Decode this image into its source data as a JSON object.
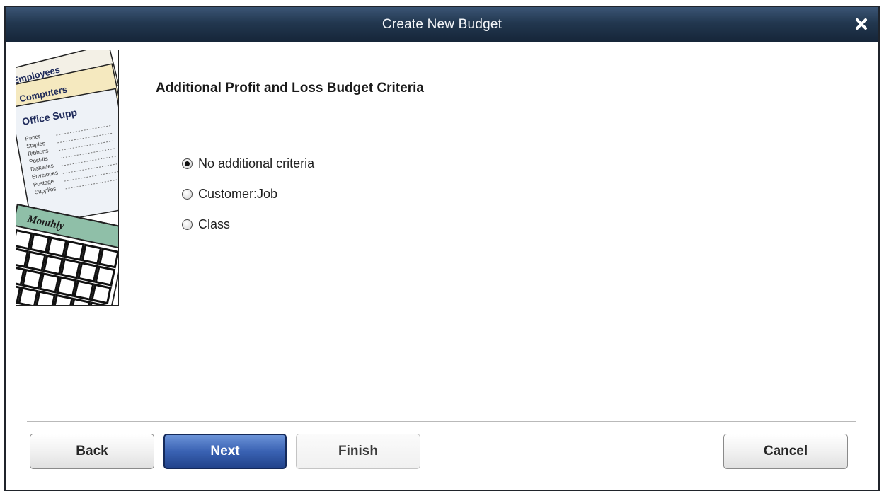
{
  "window": {
    "title": "Create New Budget"
  },
  "illustration": {
    "labels": [
      "Employees",
      "Computers",
      "Office Supp",
      "Monthly"
    ],
    "lines": [
      "Paper",
      "Staples",
      "Ribbons",
      "Post-its",
      "Diskettes",
      "Envelopes",
      "Postage",
      "Supplies"
    ]
  },
  "main": {
    "heading": "Additional Profit and Loss Budget Criteria",
    "options": [
      {
        "label": "No additional criteria",
        "selected": true
      },
      {
        "label": "Customer:Job",
        "selected": false
      },
      {
        "label": "Class",
        "selected": false
      }
    ]
  },
  "buttons": {
    "back": "Back",
    "next": "Next",
    "finish": "Finish",
    "cancel": "Cancel"
  },
  "colors": {
    "titlebar": "#22374f",
    "primary_button": "#3a62b3"
  }
}
